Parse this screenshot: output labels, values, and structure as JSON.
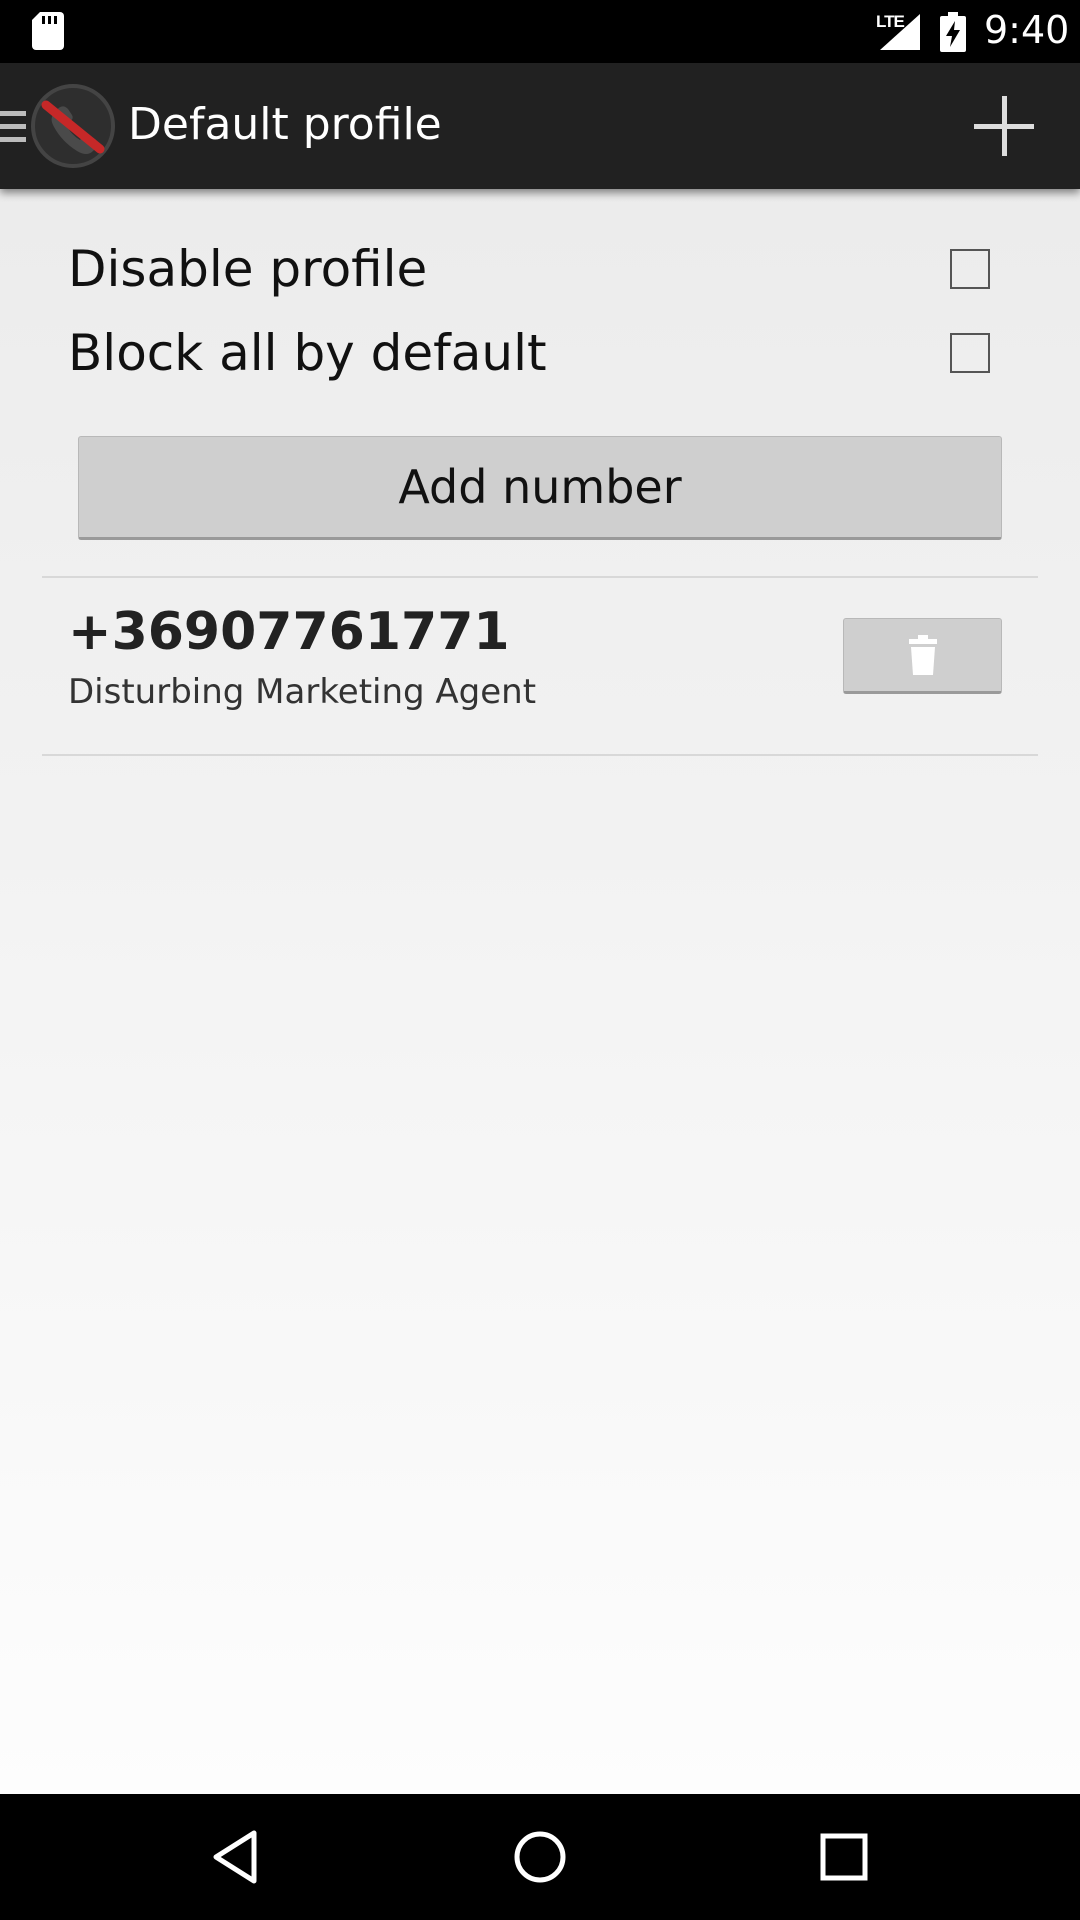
{
  "status_bar": {
    "time": "9:40",
    "network_label": "LTE",
    "icons": [
      "sd-card-icon",
      "signal-icon",
      "battery-charging-icon"
    ]
  },
  "action_bar": {
    "title": "Default profile",
    "icons": [
      "drawer-menu-icon",
      "blocked-call-logo",
      "add-icon"
    ]
  },
  "options": [
    {
      "label": "Disable profile",
      "checked": false
    },
    {
      "label": "Block all by default",
      "checked": false
    }
  ],
  "add_number_label": "Add number",
  "entries": [
    {
      "number": "+36907761771",
      "name": "Disturbing Marketing Agent",
      "delete_icon": "trash-icon"
    }
  ],
  "nav_bar": {
    "icons": [
      "back-icon",
      "home-icon",
      "recents-icon"
    ]
  },
  "colors": {
    "action_bar": "#212121",
    "logo_slash": "#c62828",
    "button": "#cfcfcf"
  }
}
